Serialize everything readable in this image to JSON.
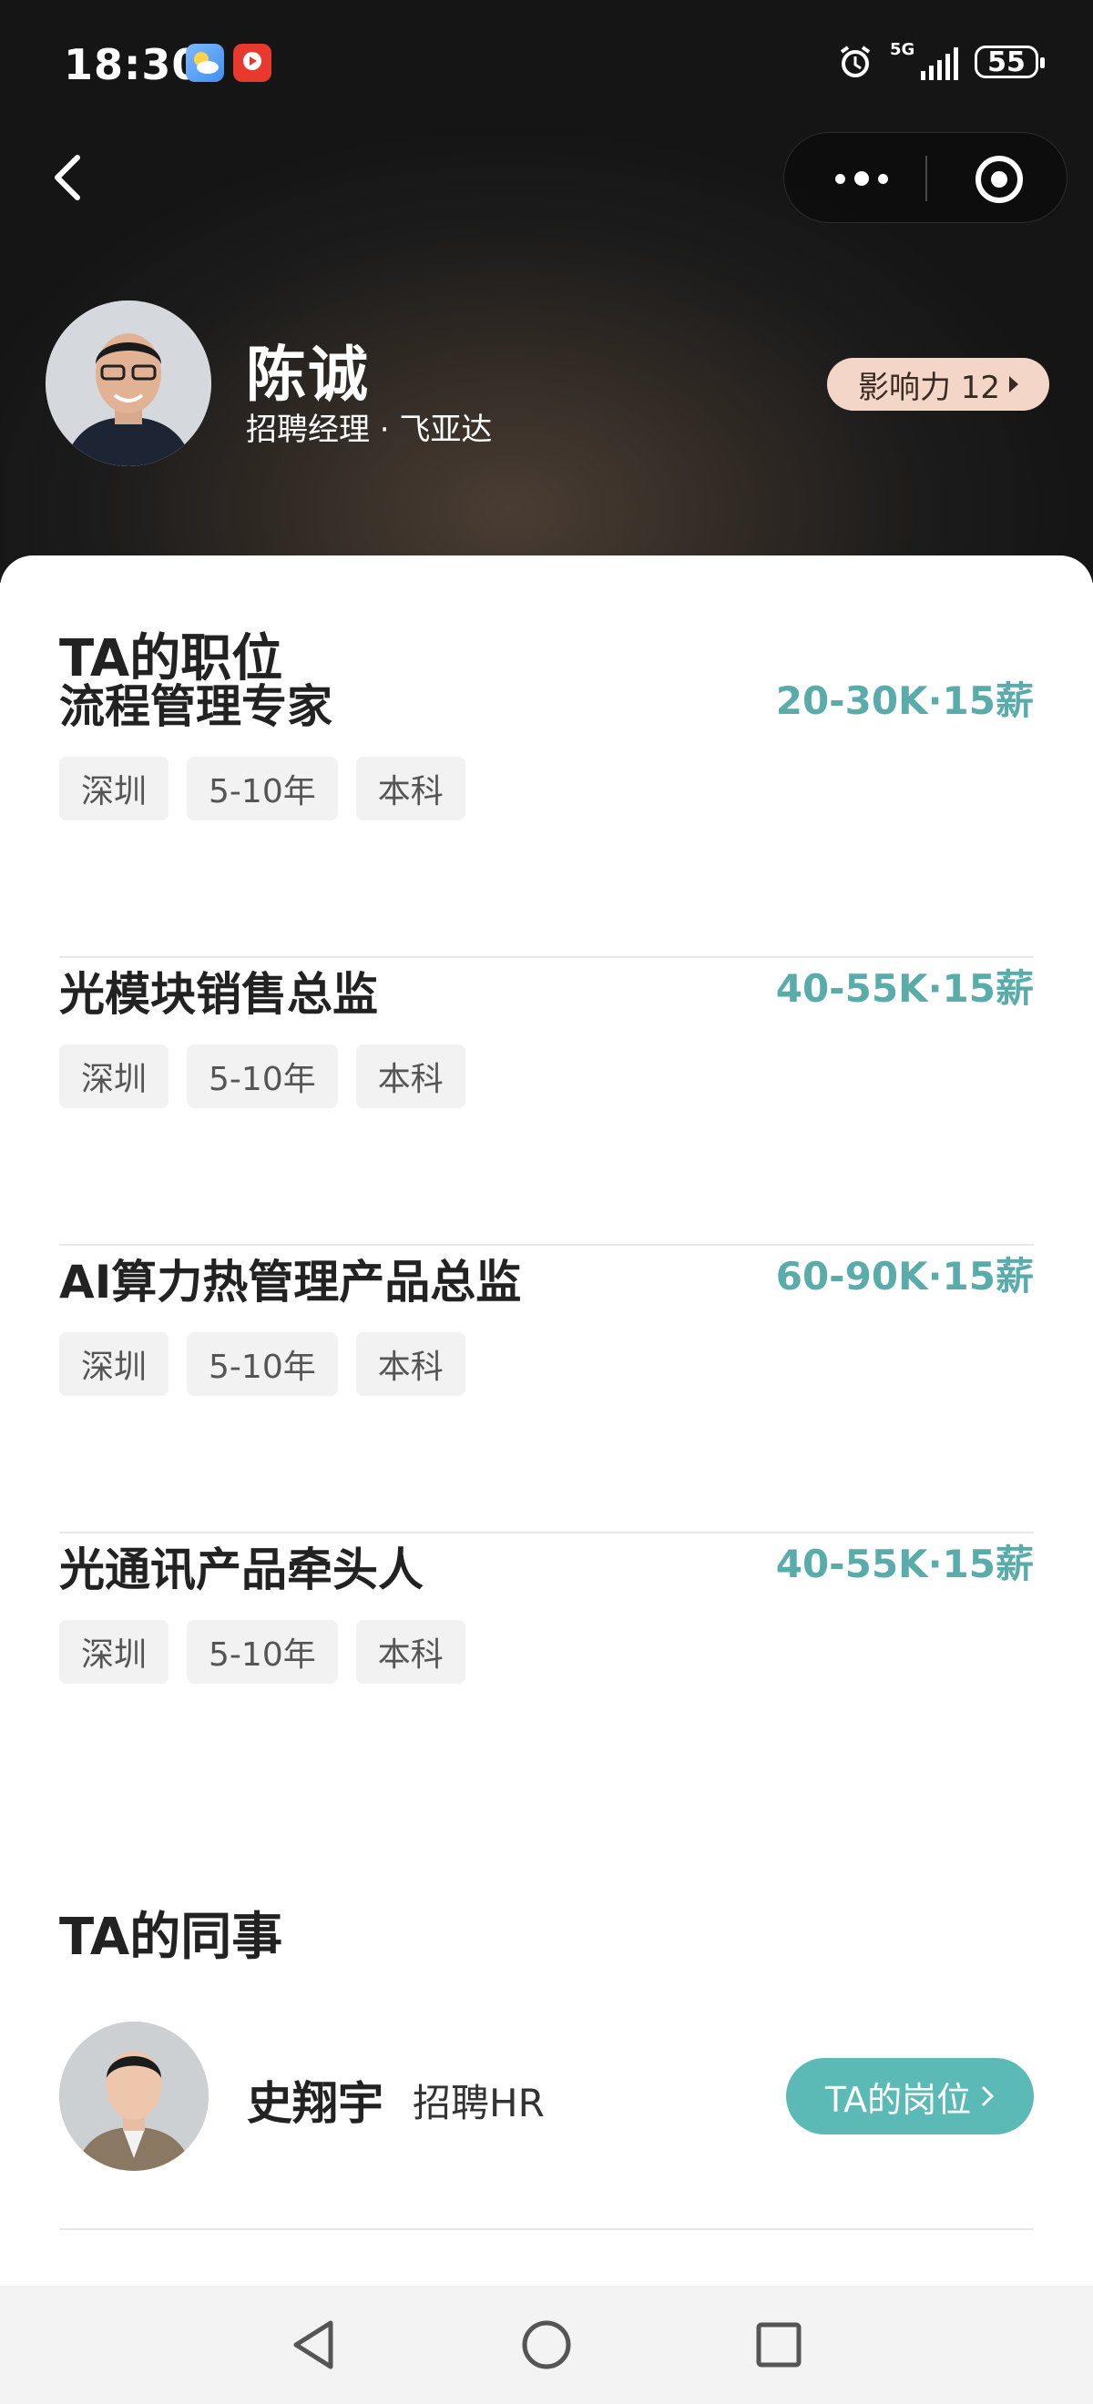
{
  "status_bar": {
    "time": "18:30",
    "network": "5G",
    "battery": "55"
  },
  "profile": {
    "name": "陈诚",
    "subtitle": "招聘经理 · 飞亚达",
    "influence_label": "影响力 12"
  },
  "jobs_section": {
    "title": "TA的职位",
    "jobs": [
      {
        "title": "流程管理专家",
        "salary": "20-30K·15薪",
        "tags": [
          "深圳",
          "5-10年",
          "本科"
        ]
      },
      {
        "title": "光模块销售总监",
        "salary": "40-55K·15薪",
        "tags": [
          "深圳",
          "5-10年",
          "本科"
        ]
      },
      {
        "title": "AI算力热管理产品总监",
        "salary": "60-90K·15薪",
        "tags": [
          "深圳",
          "5-10年",
          "本科"
        ]
      },
      {
        "title": "光通讯产品牵头人",
        "salary": "40-55K·15薪",
        "tags": [
          "深圳",
          "5-10年",
          "本科"
        ]
      }
    ]
  },
  "colleagues_section": {
    "title": "TA的同事",
    "colleagues": [
      {
        "name": "史翔宇",
        "role": "招聘HR",
        "button_label": "TA的岗位"
      }
    ]
  },
  "colors": {
    "accent": "#5aacab",
    "button": "#5bbab6",
    "influence_bg": "#f3d6c8"
  },
  "icons": [
    "back-icon",
    "more-icon",
    "close-mini-program-icon",
    "alarm-icon",
    "signal-icon",
    "battery-icon",
    "weather-app-icon",
    "video-app-icon",
    "nav-back-icon",
    "nav-home-icon",
    "nav-recents-icon"
  ]
}
